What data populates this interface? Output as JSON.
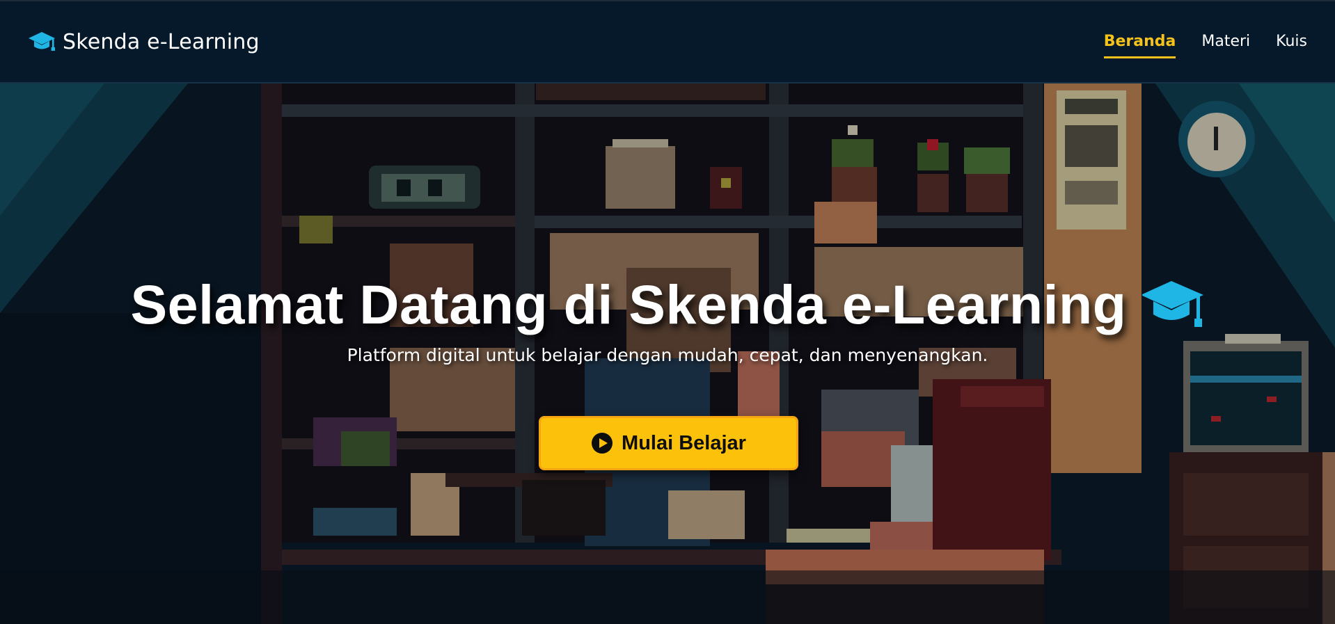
{
  "app": {
    "brand_name": "Skenda e-Learning",
    "brand_icon": "graduation-cap-icon"
  },
  "nav": {
    "items": [
      {
        "label": "Beranda",
        "active": true
      },
      {
        "label": "Materi",
        "active": false
      },
      {
        "label": "Kuis",
        "active": false
      }
    ]
  },
  "hero": {
    "title": "Selamat Datang di Skenda e-Learning",
    "title_icon": "graduation-cap-icon",
    "subtitle": "Platform digital untuk belajar dengan mudah, cepat, dan menyenangkan.",
    "cta_label": "Mulai Belajar",
    "cta_icon": "play-circle-icon",
    "background": "pixel-art-library-study-room"
  },
  "colors": {
    "navbar_bg": "#06192b",
    "accent_active": "#f5c21b",
    "cta_bg": "#fcc10a",
    "icon_cyan": "#1fb6e6",
    "text": "#ffffff"
  }
}
